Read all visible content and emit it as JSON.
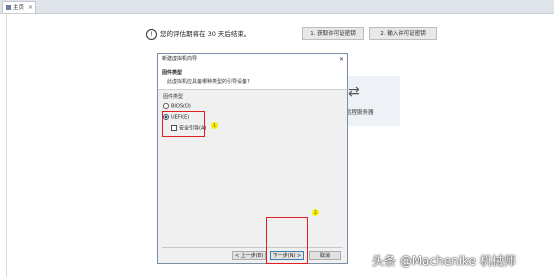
{
  "tab": {
    "label": "主页"
  },
  "info": {
    "icon_glyph": "!",
    "text": "您的评估期将在 30 天后结束。"
  },
  "buttons_top": {
    "get_license": "1. 获取许可证密钥",
    "enter_license": "2. 输入许可证密钥"
  },
  "bg_card": {
    "label": "远程服务器",
    "icon_glyph": "⇄"
  },
  "dialog": {
    "title": "新建虚拟机向导",
    "close_glyph": "✕",
    "heading": "固件类型",
    "subheading": "此虚拟机应具备哪种类型的引导设备?",
    "section_label": "固件类型",
    "options": {
      "bios": "BIOS(O)",
      "uefi": "UEFI(E)",
      "secure_boot": "安全引导(A)"
    },
    "buttons": {
      "back": "< 上一步(B)",
      "next": "下一步(N) >",
      "cancel": "取消"
    }
  },
  "markers": {
    "one": "1",
    "two": "2"
  },
  "watermark": "头条 @Machenike 机械师"
}
